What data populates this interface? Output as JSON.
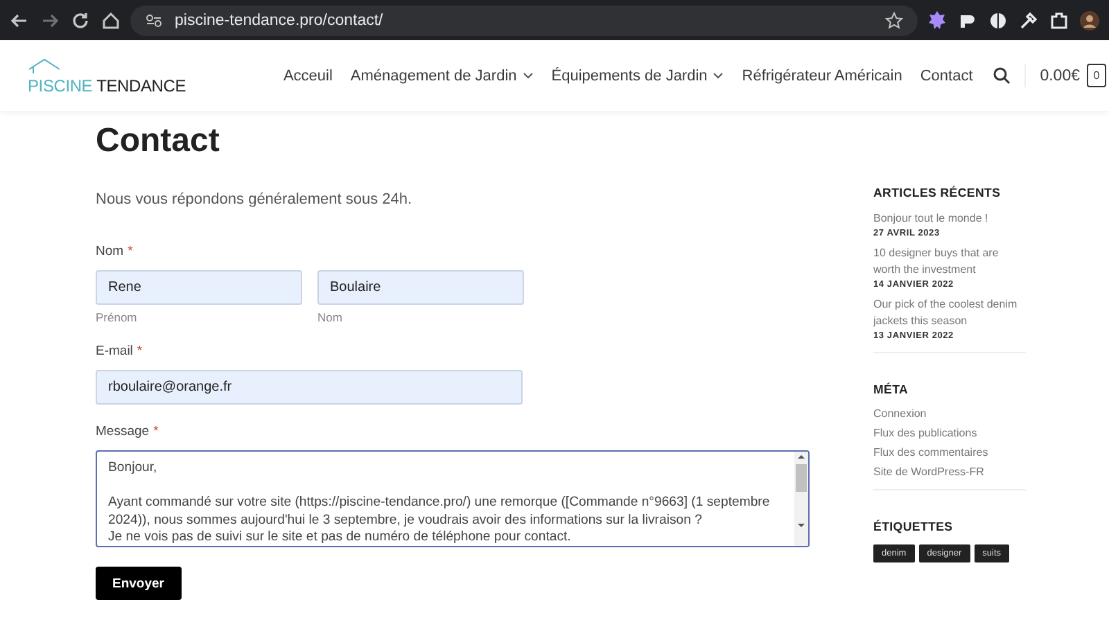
{
  "browser": {
    "url": "piscine-tendance.pro/contact/"
  },
  "header": {
    "logo": {
      "word_1": "PISCINE",
      "word_2": "TENDANCE"
    },
    "nav": [
      {
        "label": "Acceuil",
        "dropdown": false
      },
      {
        "label": "Aménagement de Jardin",
        "dropdown": true
      },
      {
        "label": "Équipements de Jardin",
        "dropdown": true
      },
      {
        "label": "Réfrigérateur Américain",
        "dropdown": false
      },
      {
        "label": "Contact",
        "dropdown": false
      }
    ],
    "cart_total": "0.00€",
    "cart_count": "0"
  },
  "page": {
    "title": "Contact",
    "intro": "Nous vous répondons généralement sous 24h."
  },
  "form": {
    "name": {
      "label": "Nom",
      "required_mark": "*",
      "first": {
        "value": "Rene",
        "caption": "Prénom"
      },
      "last": {
        "value": "Boulaire",
        "caption": "Nom"
      }
    },
    "email": {
      "label": "E-mail",
      "required_mark": "*",
      "value": "rboulaire@orange.fr"
    },
    "message": {
      "label": "Message",
      "required_mark": "*",
      "paragraphs": [
        [
          "Bonjour,"
        ],
        [
          "Ayant commandé sur votre site (https://piscine-tendance.pro/) une remorque ([Commande n°9663] (1 septembre 2024)), nous sommes aujourd'hui le 3 septembre, je voudrais avoir des informations sur la livraison ?",
          "Je ne vois pas de suivi sur le site et pas de numéro de téléphone pour contact."
        ]
      ],
      "focused": true
    },
    "submit": "Envoyer"
  },
  "sidebar": {
    "recent": {
      "title": "ARTICLES RÉCENTS",
      "posts": [
        {
          "title": "Bonjour tout le monde !",
          "date": "27 AVRIL 2023"
        },
        {
          "title": "10 designer buys that are worth the investment",
          "date": "14 JANVIER 2022"
        },
        {
          "title": "Our pick of the coolest denim jackets this season",
          "date": "13 JANVIER 2022"
        }
      ]
    },
    "meta": {
      "title": "MÉTA",
      "links": [
        "Connexion",
        "Flux des publications",
        "Flux des commentaires",
        "Site de WordPress-FR"
      ]
    },
    "tags": {
      "title": "ÉTIQUETTES",
      "items": [
        "denim",
        "designer",
        "suits"
      ]
    }
  }
}
